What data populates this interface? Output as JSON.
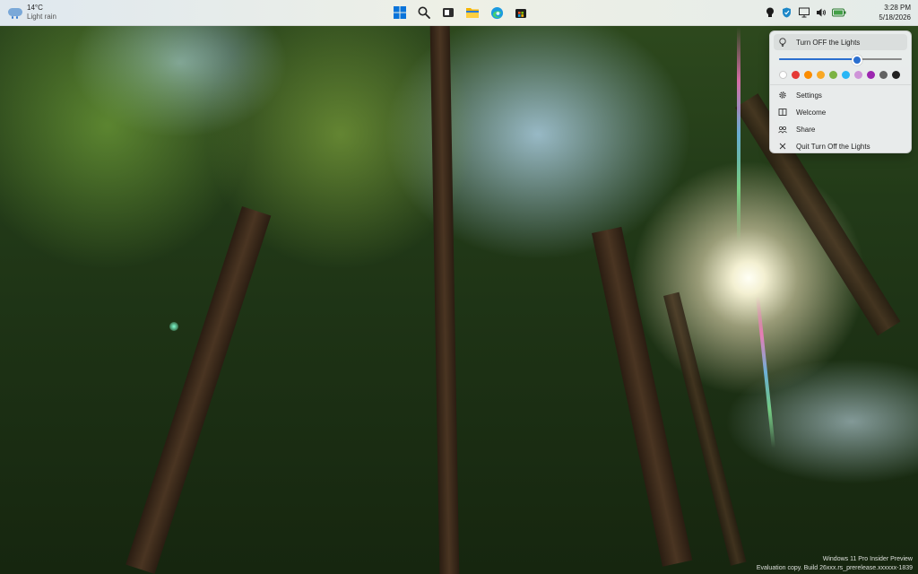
{
  "weather": {
    "temperature": "14°C",
    "condition": "Light rain"
  },
  "taskbar": {
    "center_icons": [
      "windows-start-icon",
      "search-icon",
      "task-view-icon",
      "file-explorer-icon",
      "edge-browser-icon",
      "store-icon"
    ],
    "tray_icons": [
      "lightbulb-icon",
      "shield-icon",
      "monitor-icon",
      "volume-icon",
      "battery-icon"
    ]
  },
  "clock": {
    "time": "3:28 PM",
    "date": "5/18/2026"
  },
  "menu": {
    "title": "Turn OFF the Lights",
    "brightness": 0.62,
    "colors": [
      "#ffffff",
      "#e53935",
      "#fb8c00",
      "#f9a825",
      "#7cb342",
      "#29b6f6",
      "#ce93d8",
      "#9c27b0",
      "#616161",
      "#212121"
    ],
    "items": [
      {
        "label": "Settings",
        "icon": "gear-icon"
      },
      {
        "label": "Welcome",
        "icon": "book-icon"
      },
      {
        "label": "Share",
        "icon": "share-icon"
      },
      {
        "label": "Quit Turn Off the Lights",
        "icon": "close-icon"
      }
    ]
  },
  "watermark": {
    "line1": "Windows 11 Pro Insider Preview",
    "line2": "Evaluation copy. Build 26xxx.rs_prerelease.xxxxxx-1839"
  }
}
